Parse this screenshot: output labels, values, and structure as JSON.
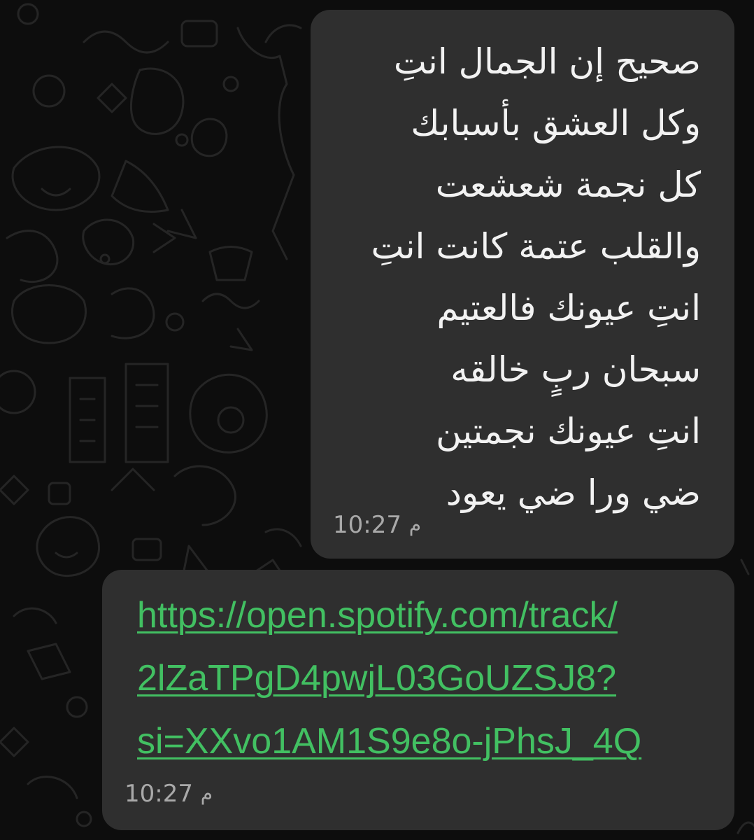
{
  "messages": [
    {
      "type": "text",
      "lines": [
        "صحيح إن الجمال انتِ",
        "وكل العشق بأسبابك",
        "كل نجمة شعشعت",
        "والقلب عتمة كانت انتِ",
        "انتِ عيونك فالعتيم",
        "سبحان ربٍ خالقه",
        "انتِ عيونك نجمتين",
        "ضي ورا ضي يعود"
      ],
      "time": "10:27",
      "meridiem": "م"
    },
    {
      "type": "link",
      "lines": [
        "https://open.spotify.com/track/",
        "2lZaTPgD4pwjL03GoUZSJ8?",
        "si=XXvo1AM1S9e8o-jPhsJ_4Q"
      ],
      "time": "10:27",
      "meridiem": "م"
    }
  ],
  "colors": {
    "background": "#0d0d0d",
    "bubble": "#2f2f2f",
    "text": "#f2f2f2",
    "link": "#42c062",
    "timestamp": "#a9a9a9"
  }
}
